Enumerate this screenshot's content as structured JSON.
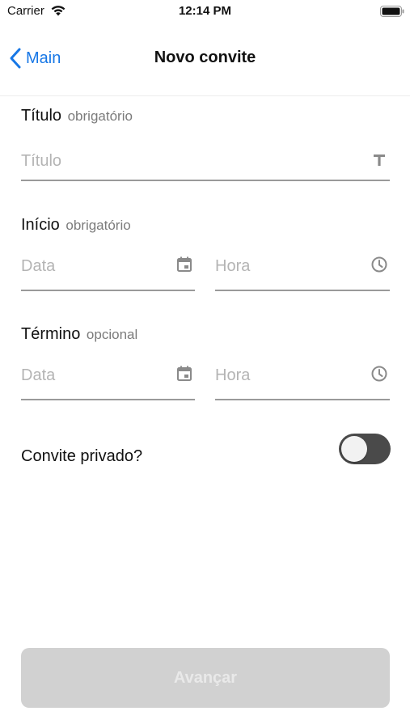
{
  "status_bar": {
    "carrier": "Carrier",
    "time": "12:14 PM",
    "wifi_icon": "wifi-icon",
    "battery_icon": "battery-icon"
  },
  "nav": {
    "back_label": "Main",
    "back_icon": "chevron-left-icon",
    "title": "Novo convite",
    "accent_color": "#1777e6"
  },
  "form": {
    "title_section": {
      "label": "Título",
      "hint": "obrigatório",
      "placeholder": "Título",
      "icon": "text-format-icon"
    },
    "start_section": {
      "label": "Início",
      "hint": "obrigatório",
      "date_placeholder": "Data",
      "date_icon": "calendar-icon",
      "time_placeholder": "Hora",
      "time_icon": "clock-icon"
    },
    "end_section": {
      "label": "Término",
      "hint": "opcional",
      "date_placeholder": "Data",
      "date_icon": "calendar-icon",
      "time_placeholder": "Hora",
      "time_icon": "clock-icon"
    },
    "private_toggle": {
      "label": "Convite privado?",
      "on": false
    }
  },
  "actions": {
    "advance_label": "Avançar",
    "enabled": false
  }
}
